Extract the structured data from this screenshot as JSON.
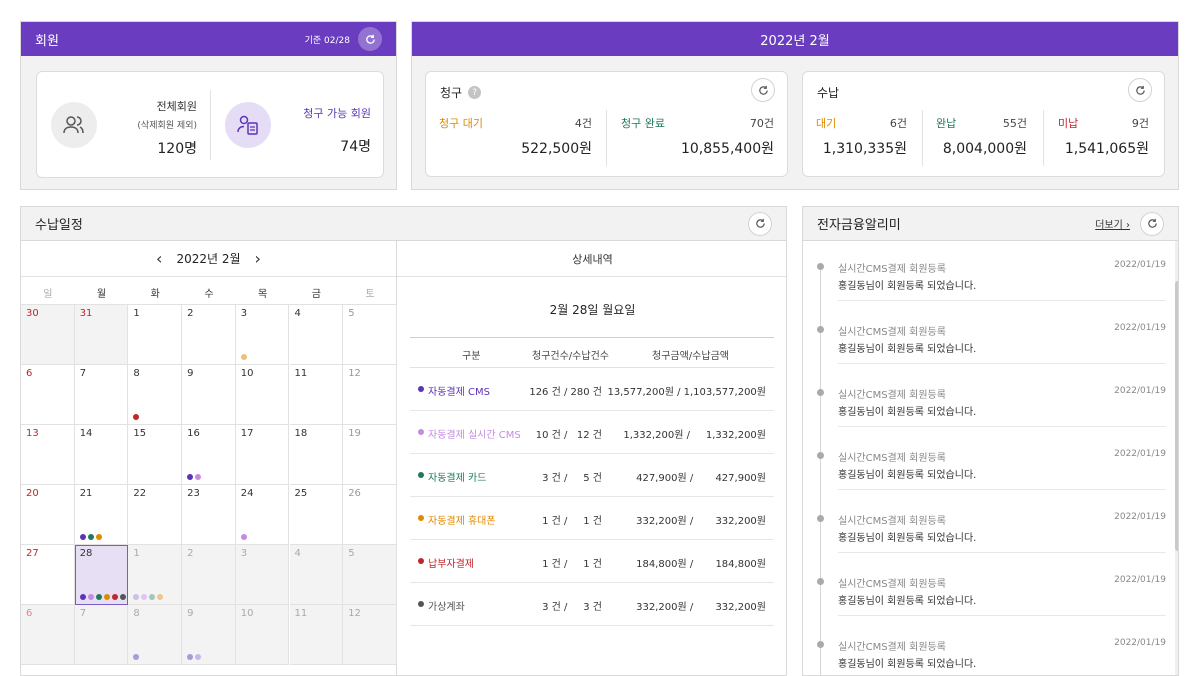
{
  "member": {
    "title": "회원",
    "as_of": "기준 02/28",
    "total_label": "전체회원",
    "total_sub": "(삭제회원 제외)",
    "total_value": "120명",
    "billable_label": "청구 가능 회원",
    "billable_value": "74명"
  },
  "month_header": "2022년 2월",
  "billing": {
    "title": "청구",
    "help": "?",
    "pending_label": "청구 대기",
    "pending_count": "4건",
    "pending_amount": "522,500원",
    "done_label": "청구 완료",
    "done_count": "70건",
    "done_amount": "10,855,400원"
  },
  "payment": {
    "title": "수납",
    "wait_label": "대기",
    "wait_count": "6건",
    "wait_amount": "1,310,335원",
    "paid_label": "완납",
    "paid_count": "55건",
    "paid_amount": "8,004,000원",
    "unpaid_label": "미납",
    "unpaid_count": "9건",
    "unpaid_amount": "1,541,065원"
  },
  "schedule": {
    "title": "수납일정",
    "month": "2022년 2월",
    "prev": "‹",
    "next": "›",
    "weekdays": [
      "일",
      "월",
      "화",
      "수",
      "목",
      "금",
      "토"
    ],
    "days": [
      "30",
      "31",
      "1",
      "2",
      "3",
      "4",
      "5",
      "6",
      "7",
      "8",
      "9",
      "10",
      "11",
      "12",
      "13",
      "14",
      "15",
      "16",
      "17",
      "18",
      "19",
      "20",
      "21",
      "22",
      "23",
      "24",
      "25",
      "26",
      "27",
      "28",
      "1",
      "2",
      "3",
      "4",
      "5",
      "6",
      "7",
      "8",
      "9",
      "10",
      "11",
      "12"
    ]
  },
  "detail": {
    "title": "상세내역",
    "date": "2월 28일 월요일",
    "headers": [
      "구분",
      "청구건수/수납건수",
      "청구금액/수납금액"
    ],
    "rows": [
      {
        "name": "자동결제 CMS",
        "count": "126 건 / 280 건",
        "amount": "13,577,200원 / 1,103,577,200원",
        "color": "#5b35b5"
      },
      {
        "name": "자동결제 실시간 CMS",
        "count": "10 건 /   12 건",
        "amount": "1,332,200원 /     1,332,200원",
        "color": "#c58be0"
      },
      {
        "name": "자동결제 카드",
        "count": "3 건 /     5 건",
        "amount": "427,900원 /       427,900원",
        "color": "#1f7a5c"
      },
      {
        "name": "자동결제 휴대폰",
        "count": "1 건 /     1 건",
        "amount": "332,200원 /       332,200원",
        "color": "#e08a00"
      },
      {
        "name": "납부자결제",
        "count": "1 건 /     1 건",
        "amount": "184,800원 /       184,800원",
        "color": "#c0262b"
      },
      {
        "name": "가상계좌",
        "count": "3 건 /     3 건",
        "amount": "332,200원 /       332,200원",
        "color": "#555555"
      }
    ]
  },
  "notify": {
    "title": "전자금융알리미",
    "more": "더보기 ›",
    "items": [
      {
        "type": "실시간CMS결제 회원등록",
        "date": "2022/01/19",
        "msg": "홍길동님이 회원등록 되었습니다."
      },
      {
        "type": "실시간CMS결제 회원등록",
        "date": "2022/01/19",
        "msg": "홍길동님이 회원등록 되었습니다."
      },
      {
        "type": "실시간CMS결제 회원등록",
        "date": "2022/01/19",
        "msg": "홍길동님이 회원등록 되었습니다."
      },
      {
        "type": "실시간CMS결제 회원등록",
        "date": "2022/01/19",
        "msg": "홍길동님이 회원등록 되었습니다."
      },
      {
        "type": "실시간CMS결제 회원등록",
        "date": "2022/01/19",
        "msg": "홍길동님이 회원등록 되었습니다."
      },
      {
        "type": "실시간CMS결제 회원등록",
        "date": "2022/01/19",
        "msg": "홍길동님이 회원등록 되었습니다."
      },
      {
        "type": "실시간CMS결제 회원등록",
        "date": "2022/01/19",
        "msg": "홍길동님이 회원등록 되었습니다."
      }
    ]
  },
  "icons": {
    "refresh": "refresh-icon",
    "users": "users-icon",
    "member_card": "member-card-icon"
  },
  "colors": {
    "purple": "#6a3dc0",
    "orange": "#e08a00",
    "green": "#1f7a5c",
    "red": "#c0262b"
  }
}
